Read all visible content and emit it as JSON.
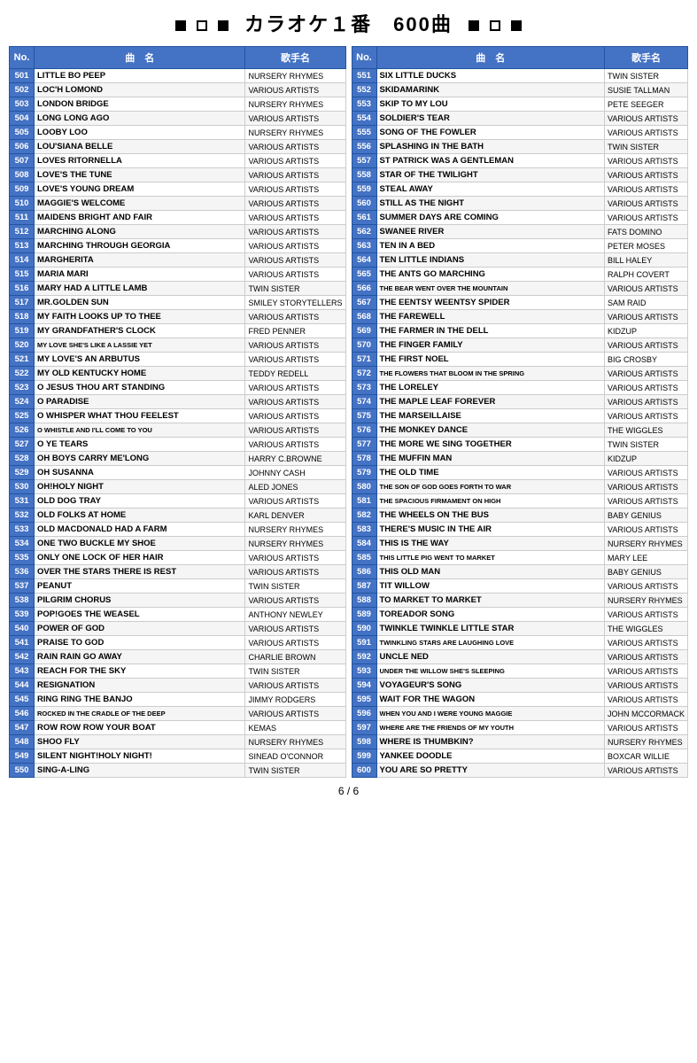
{
  "header": {
    "title": "カラオケ１番　600曲"
  },
  "footer": {
    "page": "6 / 6"
  },
  "left_table": {
    "headers": [
      "No.",
      "曲　名",
      "歌手名"
    ],
    "rows": [
      [
        "501",
        "LITTLE BO PEEP",
        "NURSERY RHYMES"
      ],
      [
        "502",
        "LOC'H LOMOND",
        "VARIOUS ARTISTS"
      ],
      [
        "503",
        "LONDON BRIDGE",
        "NURSERY RHYMES"
      ],
      [
        "504",
        "LONG LONG AGO",
        "VARIOUS ARTISTS"
      ],
      [
        "505",
        "LOOBY LOO",
        "NURSERY RHYMES"
      ],
      [
        "506",
        "LOU'SIANA BELLE",
        "VARIOUS ARTISTS"
      ],
      [
        "507",
        "LOVES RITORNELLA",
        "VARIOUS ARTISTS"
      ],
      [
        "508",
        "LOVE'S THE TUNE",
        "VARIOUS ARTISTS"
      ],
      [
        "509",
        "LOVE'S YOUNG DREAM",
        "VARIOUS ARTISTS"
      ],
      [
        "510",
        "MAGGIE'S WELCOME",
        "VARIOUS ARTISTS"
      ],
      [
        "511",
        "MAIDENS BRIGHT AND FAIR",
        "VARIOUS ARTISTS"
      ],
      [
        "512",
        "MARCHING ALONG",
        "VARIOUS ARTISTS"
      ],
      [
        "513",
        "MARCHING THROUGH GEORGIA",
        "VARIOUS ARTISTS"
      ],
      [
        "514",
        "MARGHERITA",
        "VARIOUS ARTISTS"
      ],
      [
        "515",
        "MARIA MARI",
        "VARIOUS ARTISTS"
      ],
      [
        "516",
        "MARY HAD A LITTLE LAMB",
        "TWIN SISTER"
      ],
      [
        "517",
        "MR.GOLDEN SUN",
        "SMILEY STORYTELLERS"
      ],
      [
        "518",
        "MY FAITH LOOKS UP TO THEE",
        "VARIOUS ARTISTS"
      ],
      [
        "519",
        "MY GRANDFATHER'S CLOCK",
        "FRED PENNER"
      ],
      [
        "520",
        "MY LOVE SHE'S LIKE A LASSIE YET",
        "VARIOUS ARTISTS"
      ],
      [
        "521",
        "MY LOVE'S AN ARBUTUS",
        "VARIOUS ARTISTS"
      ],
      [
        "522",
        "MY OLD KENTUCKY HOME",
        "TEDDY REDELL"
      ],
      [
        "523",
        "O JESUS THOU ART STANDING",
        "VARIOUS ARTISTS"
      ],
      [
        "524",
        "O PARADISE",
        "VARIOUS ARTISTS"
      ],
      [
        "525",
        "O WHISPER WHAT THOU FEELEST",
        "VARIOUS ARTISTS"
      ],
      [
        "526",
        "O WHISTLE AND I'LL COME TO YOU",
        "VARIOUS ARTISTS"
      ],
      [
        "527",
        "O YE TEARS",
        "VARIOUS ARTISTS"
      ],
      [
        "528",
        "OH BOYS CARRY ME'LONG",
        "HARRY C.BROWNE"
      ],
      [
        "529",
        "OH SUSANNA",
        "JOHNNY CASH"
      ],
      [
        "530",
        "OH!HOLY NIGHT",
        "ALED JONES"
      ],
      [
        "531",
        "OLD DOG TRAY",
        "VARIOUS ARTISTS"
      ],
      [
        "532",
        "OLD FOLKS AT HOME",
        "KARL DENVER"
      ],
      [
        "533",
        "OLD MACDONALD HAD A FARM",
        "NURSERY RHYMES"
      ],
      [
        "534",
        "ONE TWO BUCKLE MY SHOE",
        "NURSERY RHYMES"
      ],
      [
        "535",
        "ONLY ONE LOCK OF HER HAIR",
        "VARIOUS ARTISTS"
      ],
      [
        "536",
        "OVER THE STARS THERE IS REST",
        "VARIOUS ARTISTS"
      ],
      [
        "537",
        "PEANUT",
        "TWIN SISTER"
      ],
      [
        "538",
        "PILGRIM CHORUS",
        "VARIOUS ARTISTS"
      ],
      [
        "539",
        "POP!GOES THE WEASEL",
        "ANTHONY NEWLEY"
      ],
      [
        "540",
        "POWER OF GOD",
        "VARIOUS ARTISTS"
      ],
      [
        "541",
        "PRAISE TO GOD",
        "VARIOUS ARTISTS"
      ],
      [
        "542",
        "RAIN RAIN GO AWAY",
        "CHARLIE BROWN"
      ],
      [
        "543",
        "REACH FOR THE SKY",
        "TWIN SISTER"
      ],
      [
        "544",
        "RESIGNATION",
        "VARIOUS ARTISTS"
      ],
      [
        "545",
        "RING RING THE BANJO",
        "JIMMY RODGERS"
      ],
      [
        "546",
        "ROCKED IN THE CRADLE OF THE DEEP",
        "VARIOUS ARTISTS"
      ],
      [
        "547",
        "ROW ROW ROW YOUR BOAT",
        "KEMAS"
      ],
      [
        "548",
        "SHOO FLY",
        "NURSERY RHYMES"
      ],
      [
        "549",
        "SILENT NIGHT!HOLY NIGHT!",
        "SINEAD O'CONNOR"
      ],
      [
        "550",
        "SING-A-LING",
        "TWIN SISTER"
      ]
    ]
  },
  "right_table": {
    "headers": [
      "No.",
      "曲　名",
      "歌手名"
    ],
    "rows": [
      [
        "551",
        "SIX LITTLE DUCKS",
        "TWIN SISTER"
      ],
      [
        "552",
        "SKIDAMARINK",
        "SUSIE TALLMAN"
      ],
      [
        "553",
        "SKIP TO MY LOU",
        "PETE SEEGER"
      ],
      [
        "554",
        "SOLDIER'S TEAR",
        "VARIOUS ARTISTS"
      ],
      [
        "555",
        "SONG OF THE FOWLER",
        "VARIOUS ARTISTS"
      ],
      [
        "556",
        "SPLASHING IN THE BATH",
        "TWIN SISTER"
      ],
      [
        "557",
        "ST PATRICK WAS A GENTLEMAN",
        "VARIOUS ARTISTS"
      ],
      [
        "558",
        "STAR OF THE TWILIGHT",
        "VARIOUS ARTISTS"
      ],
      [
        "559",
        "STEAL AWAY",
        "VARIOUS ARTISTS"
      ],
      [
        "560",
        "STILL AS THE NIGHT",
        "VARIOUS ARTISTS"
      ],
      [
        "561",
        "SUMMER DAYS ARE COMING",
        "VARIOUS ARTISTS"
      ],
      [
        "562",
        "SWANEE RIVER",
        "FATS DOMINO"
      ],
      [
        "563",
        "TEN IN A BED",
        "PETER MOSES"
      ],
      [
        "564",
        "TEN LITTLE INDIANS",
        "BILL HALEY"
      ],
      [
        "565",
        "THE ANTS GO MARCHING",
        "RALPH COVERT"
      ],
      [
        "566",
        "THE BEAR WENT OVER THE MOUNTAIN",
        "VARIOUS ARTISTS"
      ],
      [
        "567",
        "THE EENTSY WEENTSY SPIDER",
        "SAM RAID"
      ],
      [
        "568",
        "THE FAREWELL",
        "VARIOUS ARTISTS"
      ],
      [
        "569",
        "THE FARMER IN THE DELL",
        "KIDZUP"
      ],
      [
        "570",
        "THE FINGER FAMILY",
        "VARIOUS ARTISTS"
      ],
      [
        "571",
        "THE FIRST NOEL",
        "BIG CROSBY"
      ],
      [
        "572",
        "THE FLOWERS THAT BLOOM IN THE SPRING",
        "VARIOUS ARTISTS"
      ],
      [
        "573",
        "THE LORELEY",
        "VARIOUS ARTISTS"
      ],
      [
        "574",
        "THE MAPLE LEAF FOREVER",
        "VARIOUS ARTISTS"
      ],
      [
        "575",
        "THE MARSEILLAISE",
        "VARIOUS ARTISTS"
      ],
      [
        "576",
        "THE MONKEY DANCE",
        "THE WIGGLES"
      ],
      [
        "577",
        "THE MORE WE SING TOGETHER",
        "TWIN SISTER"
      ],
      [
        "578",
        "THE MUFFIN MAN",
        "KIDZUP"
      ],
      [
        "579",
        "THE OLD TIME",
        "VARIOUS ARTISTS"
      ],
      [
        "580",
        "THE SON OF GOD GOES FORTH TO WAR",
        "VARIOUS ARTISTS"
      ],
      [
        "581",
        "THE SPACIOUS FIRMAMENT ON HIGH",
        "VARIOUS ARTISTS"
      ],
      [
        "582",
        "THE WHEELS ON THE BUS",
        "BABY GENIUS"
      ],
      [
        "583",
        "THERE'S MUSIC IN THE AIR",
        "VARIOUS ARTISTS"
      ],
      [
        "584",
        "THIS IS THE WAY",
        "NURSERY RHYMES"
      ],
      [
        "585",
        "THIS LITTLE PIG WENT TO MARKET",
        "MARY LEE"
      ],
      [
        "586",
        "THIS OLD MAN",
        "BABY GENIUS"
      ],
      [
        "587",
        "TIT WILLOW",
        "VARIOUS ARTISTS"
      ],
      [
        "588",
        "TO MARKET TO MARKET",
        "NURSERY RHYMES"
      ],
      [
        "589",
        "TOREADOR SONG",
        "VARIOUS ARTISTS"
      ],
      [
        "590",
        "TWINKLE TWINKLE LITTLE STAR",
        "THE WIGGLES"
      ],
      [
        "591",
        "TWINKLING STARS ARE LAUGHING LOVE",
        "VARIOUS ARTISTS"
      ],
      [
        "592",
        "UNCLE NED",
        "VARIOUS ARTISTS"
      ],
      [
        "593",
        "UNDER THE WILLOW SHE'S SLEEPING",
        "VARIOUS ARTISTS"
      ],
      [
        "594",
        "VOYAGEUR'S SONG",
        "VARIOUS ARTISTS"
      ],
      [
        "595",
        "WAIT FOR THE WAGON",
        "VARIOUS ARTISTS"
      ],
      [
        "596",
        "WHEN YOU AND I WERE YOUNG MAGGIE",
        "JOHN MCCORMACK"
      ],
      [
        "597",
        "WHERE ARE THE FRIENDS OF MY YOUTH",
        "VARIOUS ARTISTS"
      ],
      [
        "598",
        "WHERE IS THUMBKIN?",
        "NURSERY RHYMES"
      ],
      [
        "599",
        "YANKEE DOODLE",
        "BOXCAR WILLIE"
      ],
      [
        "600",
        "YOU ARE SO PRETTY",
        "VARIOUS ARTISTS"
      ]
    ]
  }
}
